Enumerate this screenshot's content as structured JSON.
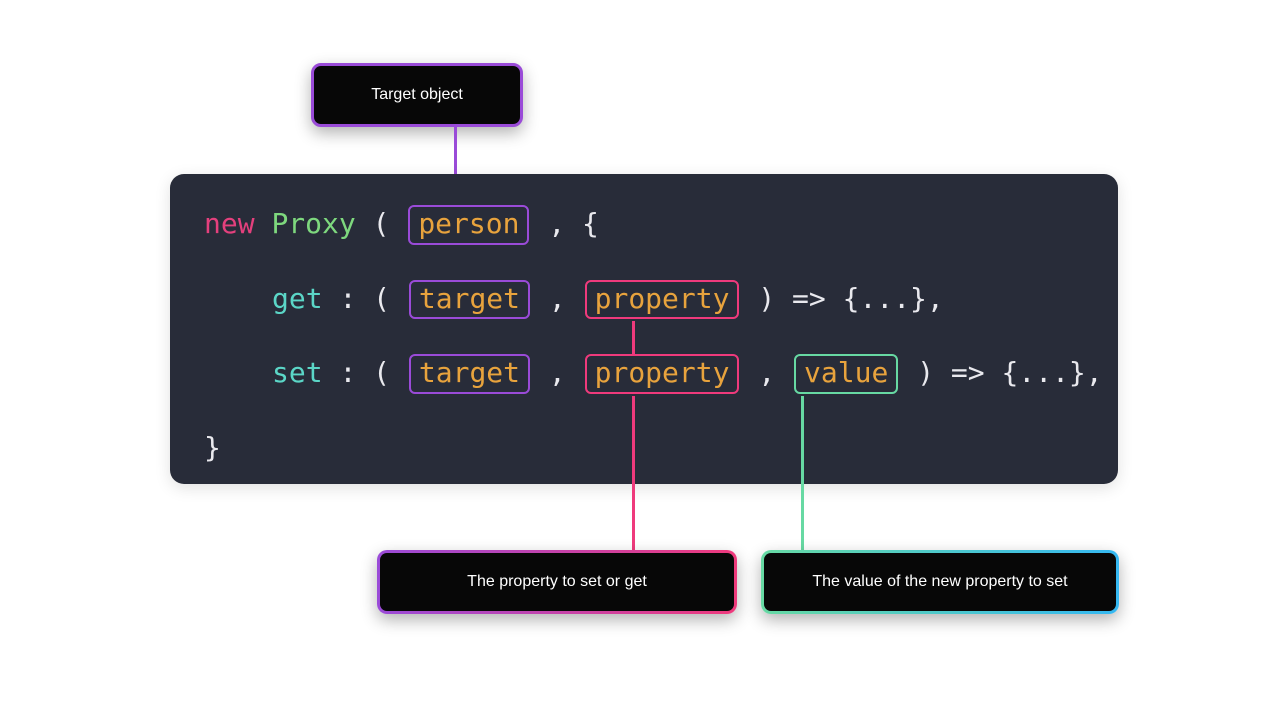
{
  "callouts": {
    "target": "Target object",
    "property": "The property to set or get",
    "value": "The value of the new property to set"
  },
  "code": {
    "kw_new": "new",
    "kw_proxy": "Proxy",
    "kw_get": "get",
    "kw_set": "set",
    "person": "person",
    "target": "target",
    "property": "property",
    "value": "value",
    "open_call": "(",
    "after_person": ", {",
    "colon_open": ": (",
    "comma_sp": ", ",
    "arrow_tail_comma": ") => {...},",
    "close_brace": "}"
  },
  "colors": {
    "bg_code": "#282c39",
    "kw_new": "#e4407d",
    "kw_proxy": "#7ed87e",
    "kw_getset": "#5bd6c7",
    "highlight": "#e8a33d",
    "plain": "#e9e9ee",
    "purple": "#9a4bd8",
    "pink": "#ef3a7c",
    "green": "#67d9a3",
    "cyan": "#35b8f2"
  }
}
